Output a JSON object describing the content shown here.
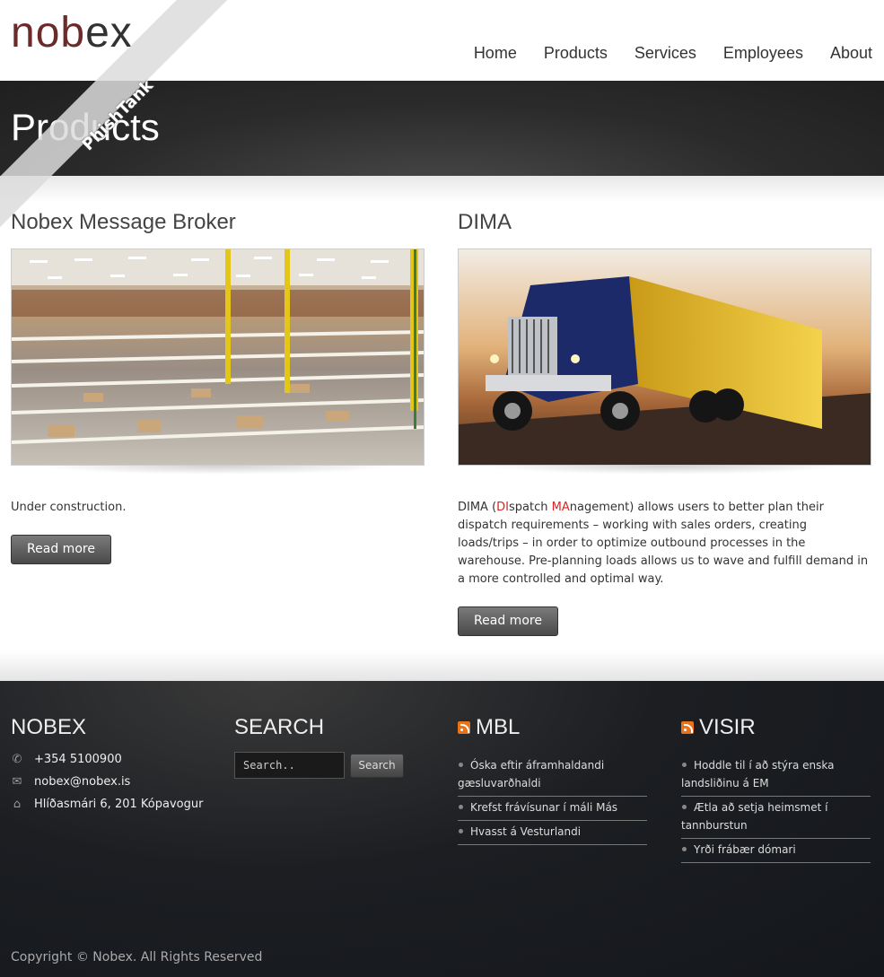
{
  "brand": {
    "logo_prefix": "nob",
    "logo_suffix": "ex",
    "colors": {
      "logo": "#6b2b2b",
      "highlight": "#dd2222"
    }
  },
  "nav": {
    "items": [
      "Home",
      "Products",
      "Services",
      "Employees",
      "About"
    ]
  },
  "page_title": "Products",
  "watermark": "PhishTank",
  "products": [
    {
      "title": "Nobex Message Broker",
      "image": "warehouse-photo",
      "description": "Under construction.",
      "button": "Read more"
    },
    {
      "title": "DIMA",
      "image": "truck-photo",
      "desc_parts": [
        "DIMA (",
        "DI",
        "spatch ",
        "MA",
        "nagement) allows users to better plan their dispatch requirements – working with sales orders, creating loads/trips – in order to optimize outbound processes in the warehouse.  Pre-planning loads allows us to wave and fulfill demand in a more controlled and optimal way."
      ],
      "button": "Read more"
    }
  ],
  "footer": {
    "nobex": {
      "heading": "NOBEX",
      "phone": "+354 5100900",
      "email": "nobex@nobex.is",
      "address": "Hlíðasmári 6, 201 Kópavogur"
    },
    "search": {
      "heading": "SEARCH",
      "placeholder": "Search..",
      "button": "Search"
    },
    "mbl": {
      "heading": "MBL",
      "items": [
        "Óska eftir áframhaldandi gæsluvarðhaldi",
        "Krefst frávísunar í máli Más",
        "Hvasst á Vesturlandi"
      ]
    },
    "visir": {
      "heading": "VISIR",
      "items": [
        "Hoddle til í að stýra enska landsliðinu á EM",
        "Ætla að setja heimsmet í tannburstun",
        "Yrði frábær dómari"
      ]
    },
    "copyright": "Copyright © Nobex. All Rights Reserved"
  }
}
